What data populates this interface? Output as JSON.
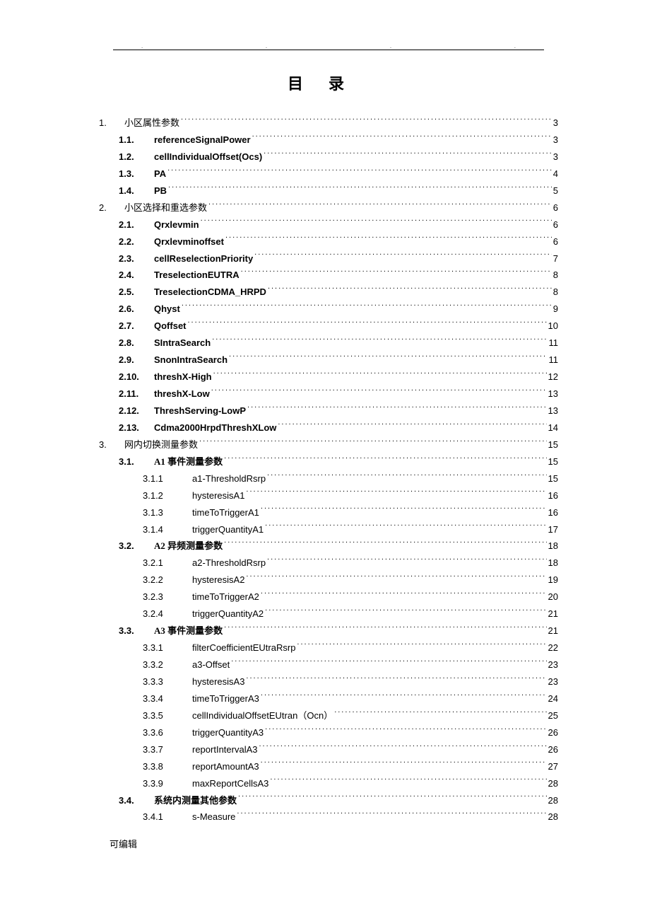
{
  "title": "目录",
  "footer": "可编辑",
  "toc": [
    {
      "level": 1,
      "num": "1.",
      "label": "小区属性参数",
      "page": "3",
      "cn": true
    },
    {
      "level": 2,
      "num": "1.1.",
      "label": "referenceSignalPower",
      "page": "3",
      "bold": true
    },
    {
      "level": 2,
      "num": "1.2.",
      "label": "cellIndividualOffset(Ocs)",
      "page": "3",
      "bold": true
    },
    {
      "level": 2,
      "num": "1.3.",
      "label": "PA",
      "page": "4",
      "bold": true
    },
    {
      "level": 2,
      "num": "1.4.",
      "label": "PB",
      "page": "5",
      "bold": true
    },
    {
      "level": 1,
      "num": "2.",
      "label": "小区选择和重选参数",
      "page": "6",
      "cn": true
    },
    {
      "level": 2,
      "num": "2.1.",
      "label": "Qrxlevmin",
      "page": "6",
      "bold": true
    },
    {
      "level": 2,
      "num": "2.2.",
      "label": "Qrxlevminoffset",
      "page": "6",
      "bold": true
    },
    {
      "level": 2,
      "num": "2.3.",
      "label": "cellReselectionPriority",
      "page": "7",
      "bold": true
    },
    {
      "level": 2,
      "num": "2.4.",
      "label": "TreselectionEUTRA",
      "page": "8",
      "bold": true
    },
    {
      "level": 2,
      "num": "2.5.",
      "label": "TreselectionCDMA_HRPD",
      "page": "8",
      "bold": true
    },
    {
      "level": 2,
      "num": "2.6.",
      "label": "Qhyst",
      "page": "9",
      "bold": true
    },
    {
      "level": 2,
      "num": "2.7.",
      "label": "Qoffset",
      "page": "10",
      "bold": true
    },
    {
      "level": 2,
      "num": "2.8.",
      "label": "SIntraSearch",
      "page": "11",
      "bold": true
    },
    {
      "level": 2,
      "num": "2.9.",
      "label": "SnonIntraSearch",
      "page": "11",
      "bold": true
    },
    {
      "level": 2,
      "num": "2.10.",
      "label": "threshX-High",
      "page": "12",
      "bold": true
    },
    {
      "level": 2,
      "num": "2.11.",
      "label": "threshX-Low",
      "page": "13",
      "bold": true
    },
    {
      "level": 2,
      "num": "2.12.",
      "label": "ThreshServing-LowP",
      "page": "13",
      "bold": true
    },
    {
      "level": 2,
      "num": "2.13.",
      "label": "Cdma2000HrpdThreshXLow",
      "page": "14",
      "bold": true
    },
    {
      "level": 1,
      "num": "3.",
      "label": "网内切换测量参数",
      "page": "15",
      "cn": true
    },
    {
      "level": 2,
      "num": "3.1.",
      "label": "A1 事件测量参数",
      "page": "15",
      "bold": true,
      "cn": true
    },
    {
      "level": 3,
      "num": "3.1.1",
      "label": "a1-ThresholdRsrp",
      "page": "15"
    },
    {
      "level": 3,
      "num": "3.1.2",
      "label": "hysteresisA1",
      "page": "16"
    },
    {
      "level": 3,
      "num": "3.1.3",
      "label": "timeToTriggerA1",
      "page": "16"
    },
    {
      "level": 3,
      "num": "3.1.4",
      "label": "triggerQuantityA1",
      "page": "17"
    },
    {
      "level": 2,
      "num": "3.2.",
      "label": "A2 异频测量参数",
      "page": "18",
      "bold": true,
      "cn": true
    },
    {
      "level": 3,
      "num": "3.2.1",
      "label": "a2-ThresholdRsrp",
      "page": "18"
    },
    {
      "level": 3,
      "num": "3.2.2",
      "label": "hysteresisA2",
      "page": "19"
    },
    {
      "level": 3,
      "num": "3.2.3",
      "label": "timeToTriggerA2",
      "page": "20"
    },
    {
      "level": 3,
      "num": "3.2.4",
      "label": "triggerQuantityA2",
      "page": "21"
    },
    {
      "level": 2,
      "num": "3.3.",
      "label": "A3 事件测量参数",
      "page": "21",
      "bold": true,
      "cn": true
    },
    {
      "level": 3,
      "num": "3.3.1",
      "label": "filterCoefficientEUtraRsrp",
      "page": "22"
    },
    {
      "level": 3,
      "num": "3.3.2",
      "label": "a3-Offset",
      "page": "23"
    },
    {
      "level": 3,
      "num": "3.3.3",
      "label": "hysteresisA3",
      "page": "23"
    },
    {
      "level": 3,
      "num": "3.3.4",
      "label": "timeToTriggerA3",
      "page": "24"
    },
    {
      "level": 3,
      "num": "3.3.5",
      "label": "cellIndividualOffsetEUtran（Ocn）",
      "page": "25"
    },
    {
      "level": 3,
      "num": "3.3.6",
      "label": "triggerQuantityA3",
      "page": "26"
    },
    {
      "level": 3,
      "num": "3.3.7",
      "label": "reportIntervalA3",
      "page": "26"
    },
    {
      "level": 3,
      "num": "3.3.8",
      "label": "reportAmountA3",
      "page": "27"
    },
    {
      "level": 3,
      "num": "3.3.9",
      "label": "maxReportCellsA3",
      "page": "28"
    },
    {
      "level": 2,
      "num": "3.4.",
      "label": "系统内测量其他参数",
      "page": "28",
      "bold": true,
      "cn": true
    },
    {
      "level": 3,
      "num": "3.4.1",
      "label": "s-Measure",
      "page": "28"
    }
  ]
}
